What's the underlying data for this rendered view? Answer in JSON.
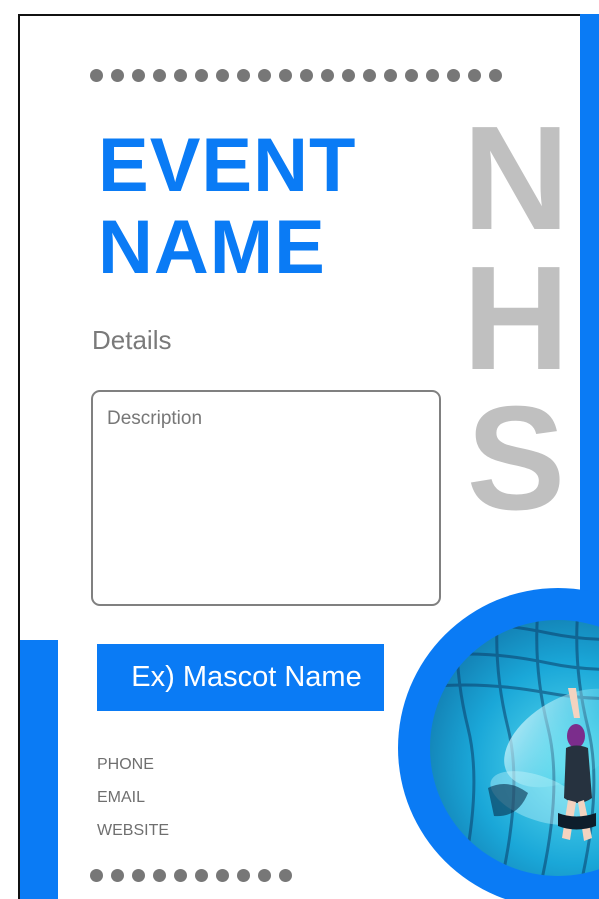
{
  "title": {
    "line1": "EVENT",
    "line2": "NAME"
  },
  "details_label": "Details",
  "description_text": "Description",
  "side_letters": [
    "N",
    "H",
    "S"
  ],
  "mascot_label": "Ex) Mascot Name",
  "contact": {
    "phone": "PHONE",
    "email": "EMAIL",
    "website": "WEBSITE"
  },
  "colors": {
    "accent": "#0a7bf5",
    "side_letters": "#c0c0c0",
    "dots": "#777777"
  },
  "photo_icon": "swimmer-photo"
}
